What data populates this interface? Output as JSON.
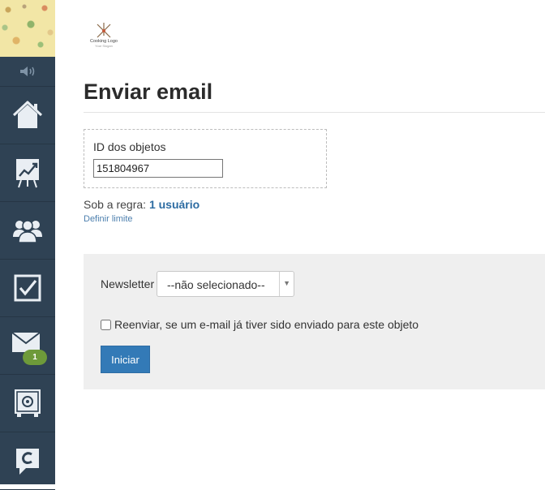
{
  "sidebar": {
    "items": [
      {
        "icon": "home-icon"
      },
      {
        "icon": "chart-board-icon"
      },
      {
        "icon": "users-icon"
      },
      {
        "icon": "checkbox-icon"
      },
      {
        "icon": "mail-icon",
        "badge": "1"
      },
      {
        "icon": "safe-icon"
      },
      {
        "icon": "c-logo-icon"
      }
    ]
  },
  "logo": {
    "line1": "Cooking Logo",
    "line2": "Your Slogan"
  },
  "page": {
    "title": "Enviar email"
  },
  "ids": {
    "label": "ID dos objetos",
    "value": "151804967"
  },
  "rule": {
    "prefix": "Sob a regra:",
    "link": "1 usuário",
    "limit_link": "Definir limite"
  },
  "newsletter": {
    "label": "Newsletter",
    "selected": "--não selecionado--"
  },
  "resend": {
    "label": "Reenviar, se um e-mail já tiver sido enviado para este objeto",
    "checked": false
  },
  "actions": {
    "start_label": "Iniciar"
  },
  "colors": {
    "sidebar": "#2f4254",
    "primary_button": "#337ab7",
    "link": "#2d6ca2",
    "badge": "#6e9a3a",
    "panel": "#efefef"
  }
}
